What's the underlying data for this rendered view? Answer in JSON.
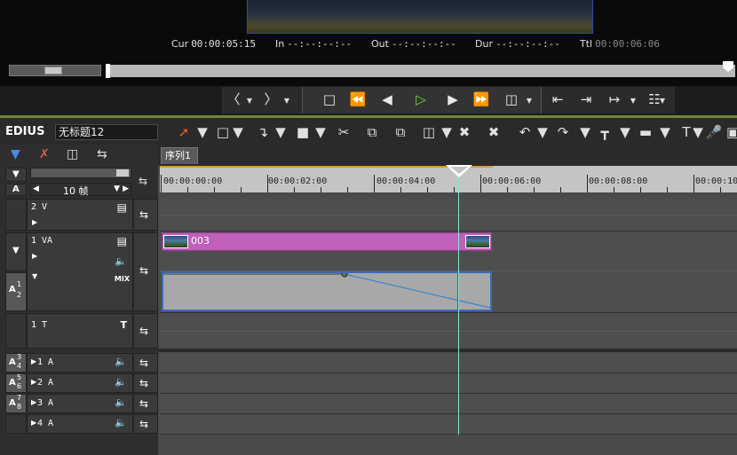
{
  "monitor": {
    "cur_label": "Cur",
    "cur_value": "00:00:05:15",
    "in_label": "In",
    "in_value": "--:--:--:--",
    "out_label": "Out",
    "out_value": "--:--:--:--",
    "dur_label": "Dur",
    "dur_value": "--:--:--:--",
    "ttl_label": "Ttl",
    "ttl_value": "00:00:06:06"
  },
  "header": {
    "app_name": "EDIUS",
    "project_name": "无标题12"
  },
  "sequence": {
    "tab_label": "序列1"
  },
  "ruler": {
    "labels": [
      "00:00:00:00",
      "00:00:02:00",
      "00:00:04:00",
      "00:00:06:00",
      "00:00:08:00",
      "00:00:10"
    ]
  },
  "controls": {
    "zoom_label": "10 帧"
  },
  "tracks": {
    "v2": {
      "name": "2 V"
    },
    "va1": {
      "name": "1 VA",
      "mix_label": "MIX"
    },
    "t1": {
      "name": "1 T"
    },
    "a1": {
      "name": "1 A"
    },
    "a2": {
      "name": "2 A"
    },
    "a3": {
      "name": "3 A"
    },
    "a4": {
      "name": "4 A"
    }
  },
  "clips": {
    "video_clip_name": "003"
  },
  "side_labels": {
    "a12": "A",
    "a12_sup": "1",
    "a12_sub": "2",
    "a34": "A",
    "a34_sup": "3",
    "a34_sub": "4",
    "a56": "A",
    "a56_sup": "5",
    "a56_sub": "6",
    "a78": "A",
    "a78_sup": "7",
    "a78_sub": "8"
  },
  "colors": {
    "video_clip": "#c060b8",
    "audio_clip": "#a8a8a8",
    "playhead": "#7fe8d8",
    "accent_green": "#6a8a3a"
  }
}
